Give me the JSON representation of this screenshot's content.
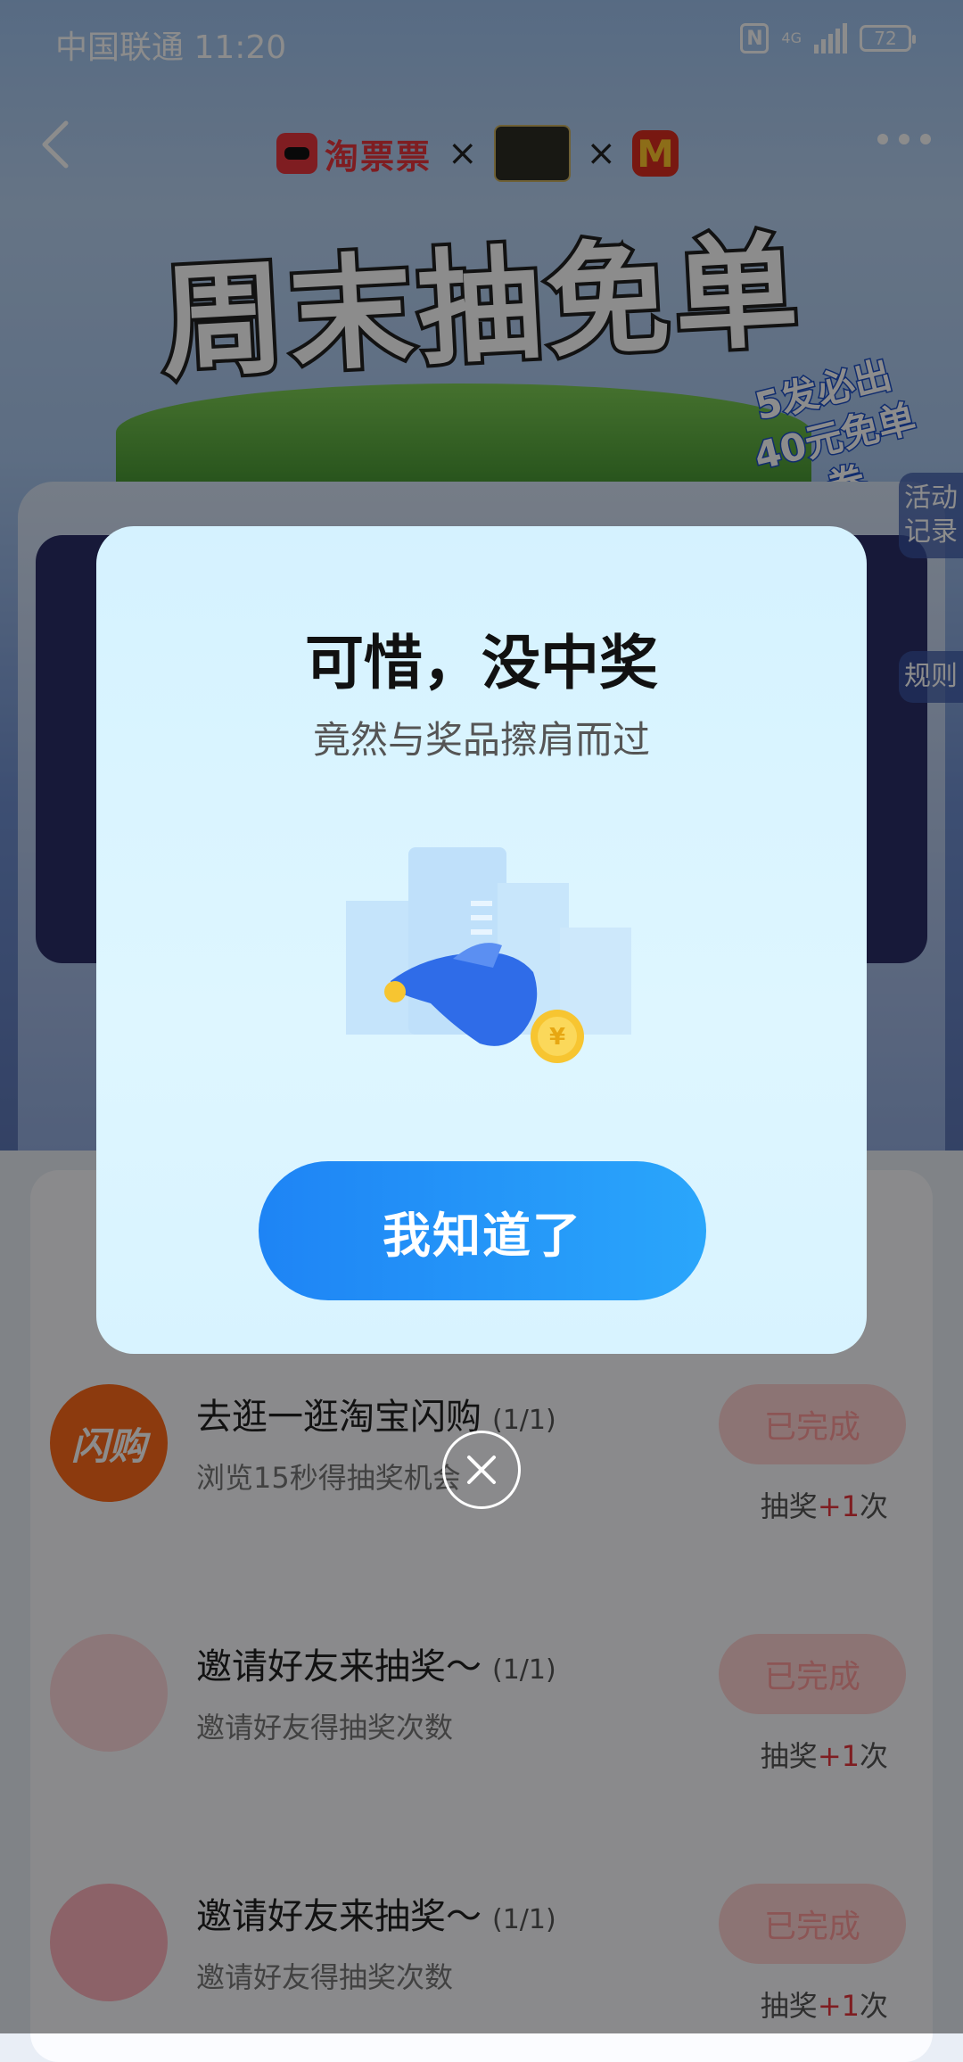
{
  "status_bar": {
    "carrier_time": "中国联通 11:20",
    "network": "4G",
    "battery": "72"
  },
  "header": {
    "brands": [
      "淘票票",
      "×",
      "×"
    ],
    "title_banner": "周末抽免单",
    "badge": "5发必出 40元免单券",
    "side_tabs": [
      "活动记录",
      "规则"
    ]
  },
  "dialog": {
    "title": "可惜，没中奖",
    "subtitle": "竟然与奖品擦肩而过",
    "confirm_label": "我知道了"
  },
  "tasks": [
    {
      "icon_text": "闪购",
      "title": "去逛一逛淘宝闪购",
      "count": "(1/1)",
      "desc": "浏览15秒得抽奖机会",
      "button": "已完成",
      "reward_prefix": "抽奖",
      "reward_num": "+1",
      "reward_suffix": "次"
    },
    {
      "icon_text": "",
      "title": "邀请好友来抽奖～",
      "count": "(1/1)",
      "desc": "邀请好友得抽奖次数",
      "button": "已完成",
      "reward_prefix": "抽奖",
      "reward_num": "+1",
      "reward_suffix": "次"
    },
    {
      "icon_text": "",
      "title": "邀请好友来抽奖～",
      "count": "(1/1)",
      "desc": "邀请好友得抽奖次数",
      "button": "已完成",
      "reward_prefix": "抽奖",
      "reward_num": "+1",
      "reward_suffix": "次"
    }
  ],
  "icons": [
    "back-icon",
    "more-icon",
    "nfc-icon",
    "signal-icon",
    "battery-icon",
    "close-icon",
    "hand-coin-illustration"
  ],
  "colors": {
    "primary_button": "#1e84f5",
    "dialog_bg": "#d8f3ff",
    "reward_plus": "#e8353d",
    "done_button": "#ffd3d3"
  }
}
